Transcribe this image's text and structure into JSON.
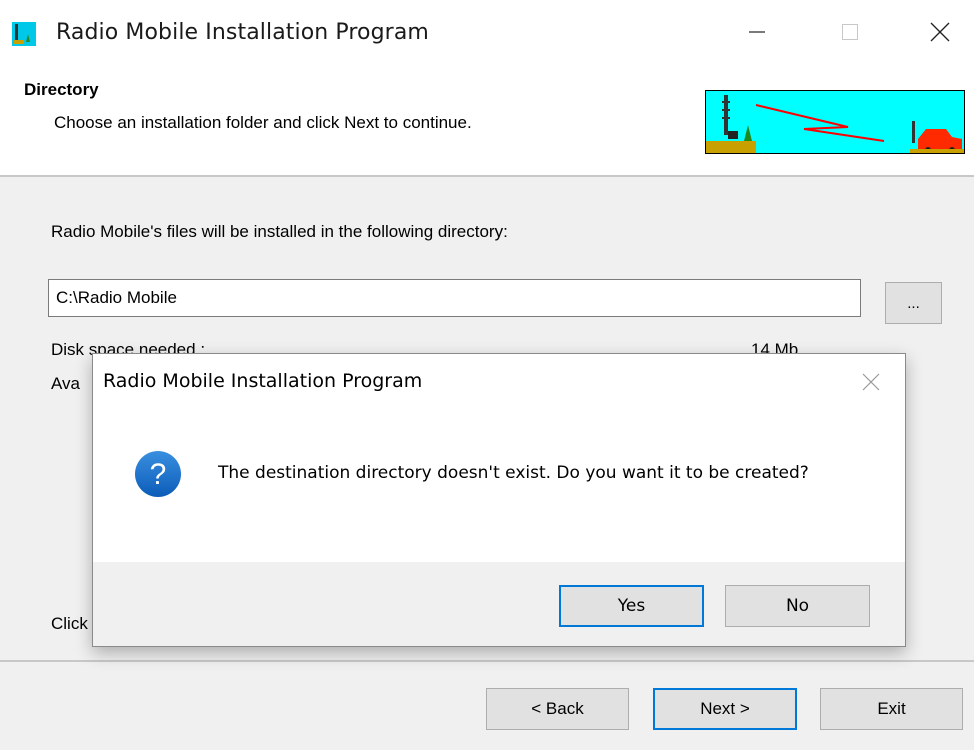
{
  "window": {
    "title": "Radio Mobile Installation Program",
    "icon": "radio-mobile-app-icon"
  },
  "header": {
    "title": "Directory",
    "subtitle": "Choose an installation folder and click Next to continue.",
    "banner_icon": "radio-tower-car-banner"
  },
  "content": {
    "dir_label": "Radio Mobile's files will be installed in the following directory:",
    "dir_value": "C:\\Radio Mobile",
    "browse_label": "...",
    "disk_label": "Disk space needed :",
    "disk_value": "14 Mb",
    "avail_label": "Ava",
    "click_label": "Click"
  },
  "footer": {
    "back": "< Back",
    "next": "Next >",
    "exit": "Exit"
  },
  "dialog": {
    "title": "Radio Mobile Installation Program",
    "message": "The destination directory doesn't exist. Do you want it to be created?",
    "icon": "question-icon",
    "yes": "Yes",
    "no": "No"
  },
  "colors": {
    "accent": "#0078d7",
    "banner_bg": "#00ffff",
    "window_bg": "#f0f0f0"
  }
}
